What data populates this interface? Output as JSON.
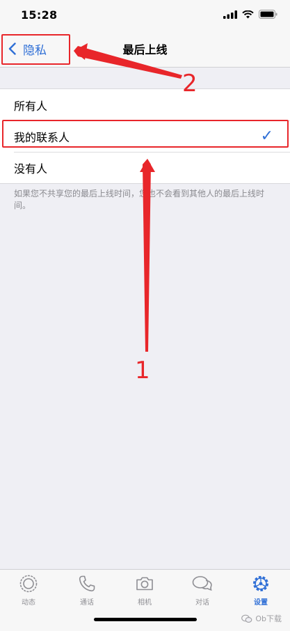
{
  "status_bar": {
    "time": "15:28"
  },
  "nav": {
    "back_label": "隐私",
    "title": "最后上线"
  },
  "options": [
    {
      "label": "所有人",
      "selected": false
    },
    {
      "label": "我的联系人",
      "selected": true
    },
    {
      "label": "没有人",
      "selected": false
    }
  ],
  "check_mark": "✓",
  "footnote": "如果您不共享您的最后上线时间，您也不会看到其他人的最后上线时间。",
  "annotations": {
    "marker_1": "1",
    "marker_2": "2",
    "color": "#e8262a"
  },
  "tabs": [
    {
      "label": "动态",
      "icon": "status-icon",
      "active": false
    },
    {
      "label": "通话",
      "icon": "phone-icon",
      "active": false
    },
    {
      "label": "相机",
      "icon": "camera-icon",
      "active": false
    },
    {
      "label": "对话",
      "icon": "chats-icon",
      "active": false
    },
    {
      "label": "设置",
      "icon": "settings-icon",
      "active": true
    }
  ],
  "watermark": "Ob下载",
  "colors": {
    "accent": "#2f6fd6",
    "background": "#efeff4",
    "annotation": "#e8262a"
  }
}
